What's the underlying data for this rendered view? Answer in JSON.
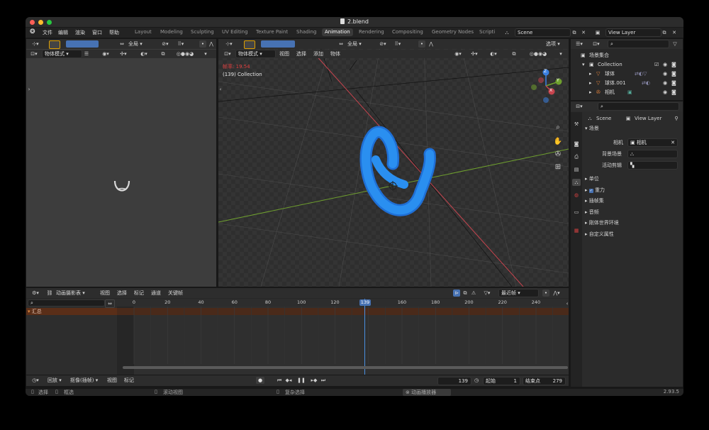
{
  "window": {
    "title": "2.blend",
    "version": "2.93.5"
  },
  "menubar": {
    "menus": [
      "文件",
      "编辑",
      "渲染",
      "窗口",
      "帮助"
    ],
    "workspaces": [
      "Layout",
      "Modeling",
      "Sculpting",
      "UV Editing",
      "Texture Paint",
      "Shading",
      "Animation",
      "Rendering",
      "Compositing",
      "Geometry Nodes",
      "Scripti"
    ],
    "active_workspace": "Animation",
    "scene": "Scene",
    "view_layer": "View Layer"
  },
  "left_viewport": {
    "mode": "物体模式",
    "orientation": "全局"
  },
  "viewport": {
    "mode": "物体模式",
    "orientation": "全局",
    "menus": [
      "视图",
      "选择",
      "添加",
      "物体"
    ],
    "options_label": "选项",
    "fps_label": "帧率: 19.54",
    "overlay_text": "(139) Collection",
    "axis_labels": {
      "x": "X",
      "y": "Y",
      "z": "Z"
    }
  },
  "outliner": {
    "root": "场景集合",
    "items": [
      {
        "label": "Collection"
      },
      {
        "label": "球体"
      },
      {
        "label": "球体.001"
      },
      {
        "label": "相机"
      }
    ]
  },
  "properties": {
    "breadcrumb_scene": "Scene",
    "breadcrumb_layer": "View Layer",
    "section_scene": "场景",
    "camera_label": "相机",
    "camera_value": "相机",
    "bg_scene_label": "背景场景",
    "active_clip_label": "活动剪辑",
    "sections": [
      "单位",
      "重力",
      "插帧集",
      "音频",
      "刚体世界环境",
      "自定义属性"
    ]
  },
  "dopesheet": {
    "mode": "动画摄影表",
    "menus": [
      "视图",
      "选择",
      "标记",
      "通道",
      "关键帧"
    ],
    "interp": "最近帧",
    "summary": "汇总",
    "ruler_ticks": [
      "0",
      "20",
      "40",
      "60",
      "80",
      "100",
      "120",
      "140",
      "160",
      "180",
      "200",
      "220",
      "240"
    ],
    "current_frame": "139"
  },
  "timeline": {
    "menus": [
      "回放",
      "抠像(插帧)",
      "视图",
      "标记"
    ],
    "current": "139",
    "start_label": "起始",
    "start": "1",
    "end_label": "结束点",
    "end": "279"
  },
  "statusbar": {
    "select": "选择",
    "box_select": "框选",
    "rotate_view": "滚动视图",
    "context_menu": "复杂选择",
    "player": "动画播放器"
  },
  "colors": {
    "accent": "#4772b3",
    "curve": "#2a8ff0",
    "x_axis": "#c7444e",
    "y_axis": "#6fa02e",
    "z_axis": "#3a7fe0"
  }
}
